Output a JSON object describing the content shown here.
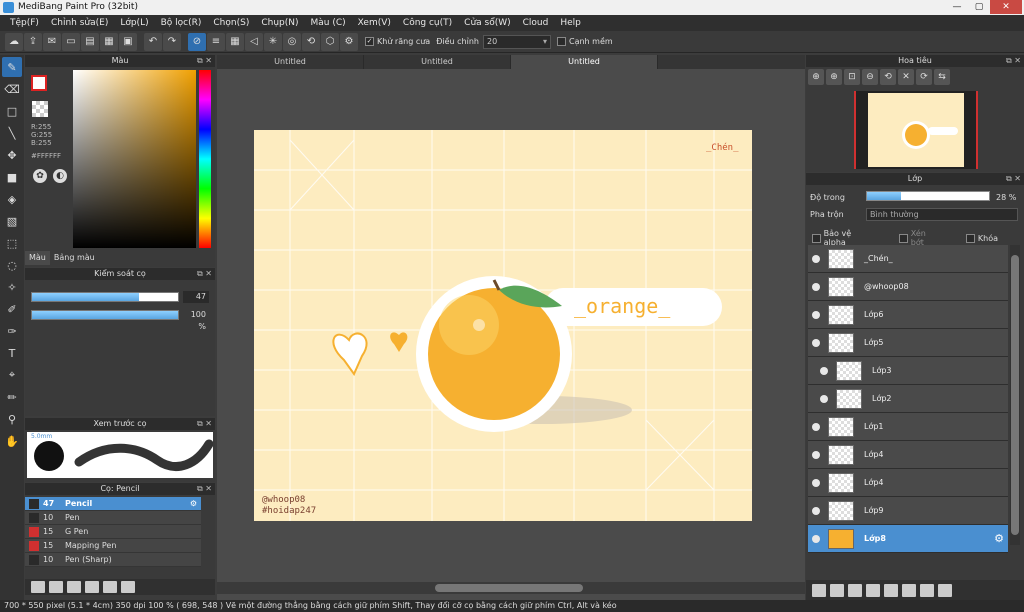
{
  "window": {
    "title": "MediBang Paint Pro (32bit)",
    "minimize": "—",
    "maximize": "▢",
    "close": "✕"
  },
  "menu": [
    "Tệp(F)",
    "Chỉnh sửa(E)",
    "Lớp(L)",
    "Bộ lọc(R)",
    "Chọn(S)",
    "Chụp(N)",
    "Màu (C)",
    "Xem(V)",
    "Công cụ(T)",
    "Cửa sổ(W)",
    "Cloud",
    "Help"
  ],
  "toolbar": {
    "antialias_label": "Khử răng cưa",
    "correction_label": "Điều chỉnh",
    "correction_value": "20",
    "edge_label": "Cạnh mềm"
  },
  "color_panel": {
    "title": "Màu",
    "rgb": {
      "r": "R:255",
      "g": "G:255",
      "b": "B:255"
    },
    "hex": "#FFFFFF",
    "tabs": [
      "Màu",
      "Bảng màu"
    ]
  },
  "brush_control": {
    "title": "Kiểm soát cọ",
    "size_value": "47",
    "opacity_value": "100 %",
    "size_fraction": 0.73,
    "opacity_fraction": 1.0
  },
  "brush_preview": {
    "title": "Xem trước cọ",
    "size_label": "5.0mm"
  },
  "brush_list": {
    "title": "Cọ: Pencil",
    "items": [
      {
        "size": "47",
        "name": "Pencil",
        "swatch": "dark",
        "selected": true
      },
      {
        "size": "10",
        "name": "Pen",
        "swatch": "dark",
        "selected": false
      },
      {
        "size": "15",
        "name": "G Pen",
        "swatch": "red",
        "selected": false
      },
      {
        "size": "15",
        "name": "Mapping Pen",
        "swatch": "red",
        "selected": false
      },
      {
        "size": "10",
        "name": "Pen (Sharp)",
        "swatch": "dark",
        "selected": false
      }
    ]
  },
  "canvas": {
    "tabs": [
      "Untitled",
      "Untitled",
      "Untitled"
    ],
    "active_tab": 2,
    "signature": "_Chén_",
    "word": "_orange_",
    "credits1": "@whoop08",
    "credits2": "#hoidap247"
  },
  "navigator": {
    "title": "Hoa tiêu"
  },
  "layer_panel": {
    "title": "Lớp",
    "opacity_label": "Độ trong",
    "opacity_value": "28 %",
    "opacity_fraction": 0.28,
    "blend_label": "Pha trộn",
    "blend_value": "Bình thường",
    "protect_alpha": "Bảo vệ alpha",
    "clipping": "Xén bớt",
    "lock": "Khóa",
    "layers": [
      {
        "name": "_Chén_",
        "thumb": "text",
        "sub": false,
        "selected": false
      },
      {
        "name": "@whoop08",
        "thumb": "text",
        "sub": false,
        "selected": false
      },
      {
        "name": "Lớp6",
        "thumb": "blank",
        "sub": false,
        "selected": false
      },
      {
        "name": "Lớp5",
        "thumb": "blank",
        "sub": false,
        "selected": false
      },
      {
        "name": "Lớp3",
        "thumb": "blank",
        "sub": true,
        "selected": false
      },
      {
        "name": "Lớp2",
        "thumb": "blank",
        "sub": true,
        "selected": false
      },
      {
        "name": "Lớp1",
        "thumb": "blank",
        "sub": false,
        "selected": false
      },
      {
        "name": "Lớp4",
        "thumb": "blank",
        "sub": false,
        "selected": false
      },
      {
        "name": "Lớp4",
        "thumb": "blank",
        "sub": false,
        "selected": false
      },
      {
        "name": "Lớp9",
        "thumb": "blank",
        "sub": false,
        "selected": false
      },
      {
        "name": "Lớp8",
        "thumb": "orange",
        "sub": false,
        "selected": true
      }
    ]
  },
  "status": {
    "text": "700 * 550 pixel   (5.1 * 4cm)   350 dpi   100 %   ( 698, 548 )   Vẽ một đường thẳng bằng cách giữ phím Shift, Thay đổi cỡ cọ bằng cách giữ phím Ctrl, Alt và kéo"
  },
  "colors": {
    "accent": "#4a8fd0",
    "orange": "#f6b030",
    "canvas_bg": "#fdecc0"
  }
}
